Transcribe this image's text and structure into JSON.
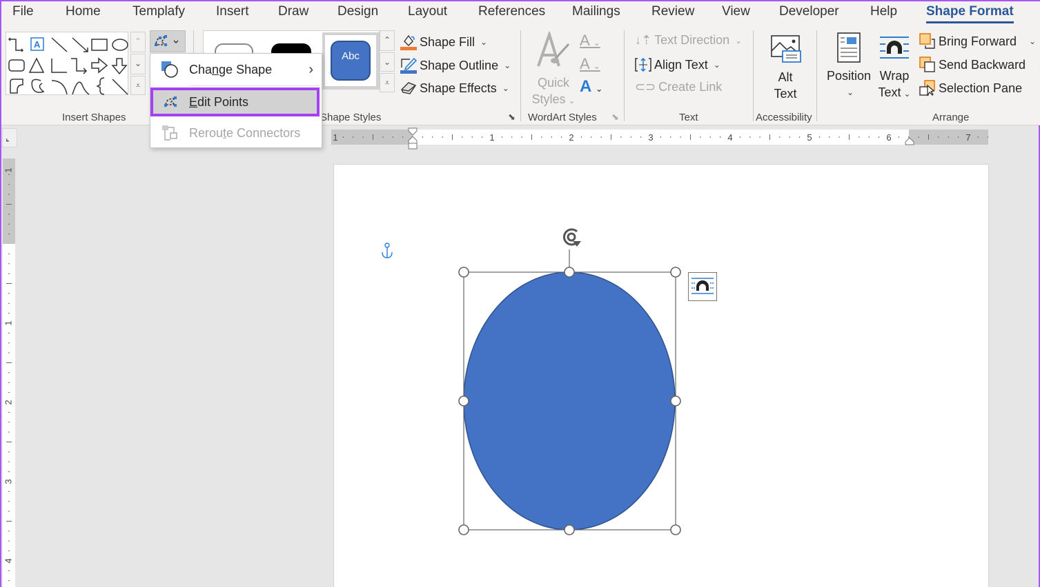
{
  "tabs": [
    {
      "label": "File"
    },
    {
      "label": "Home"
    },
    {
      "label": "Templafy"
    },
    {
      "label": "Insert"
    },
    {
      "label": "Draw"
    },
    {
      "label": "Design"
    },
    {
      "label": "Layout"
    },
    {
      "label": "References"
    },
    {
      "label": "Mailings"
    },
    {
      "label": "Review"
    },
    {
      "label": "View"
    },
    {
      "label": "Developer"
    },
    {
      "label": "Help"
    },
    {
      "label": "Shape Format"
    }
  ],
  "active_tab": "Shape Format",
  "groups": {
    "insert_shapes": "Insert Shapes",
    "shape_styles": "Shape Styles",
    "wordart_styles": "WordArt Styles",
    "text": "Text",
    "accessibility": "Accessibility",
    "arrange": "Arrange"
  },
  "shape_styles": {
    "preview_text": "Abc",
    "shape_fill": "Shape Fill",
    "shape_outline": "Shape Outline",
    "shape_effects": "Shape Effects"
  },
  "wordart": {
    "quick": "Quick",
    "styles": "Styles"
  },
  "text_group": {
    "text_direction": "Text Direction",
    "align_text": "Align Text",
    "create_link": "Create Link"
  },
  "accessibility": {
    "alt": "Alt",
    "text": "Text"
  },
  "arrange": {
    "position": "Position",
    "wrap": "Wrap",
    "wrap_text": "Text",
    "bring_forward": "Bring Forward",
    "send_backward": "Send Backward",
    "selection_pane": "Selection Pane"
  },
  "edit_shape_menu": {
    "change_shape_pre": "Cha",
    "change_shape_u": "n",
    "change_shape_post": "ge Shape",
    "edit_points_u": "E",
    "edit_points_post": "dit Points",
    "reroute_pre": "Rerou",
    "reroute_u": "t",
    "reroute_post": "e Connectors"
  },
  "ruler": {
    "h_labels": [
      "1",
      "1",
      "2",
      "3",
      "4",
      "5",
      "6",
      "7"
    ],
    "v_labels": [
      "1",
      "1",
      "2",
      "3",
      "4"
    ]
  },
  "colors": {
    "accent": "#2b579a",
    "shape_fill": "#4472c4",
    "shape_outline": "#2f528f",
    "highlight": "#a442f0"
  }
}
